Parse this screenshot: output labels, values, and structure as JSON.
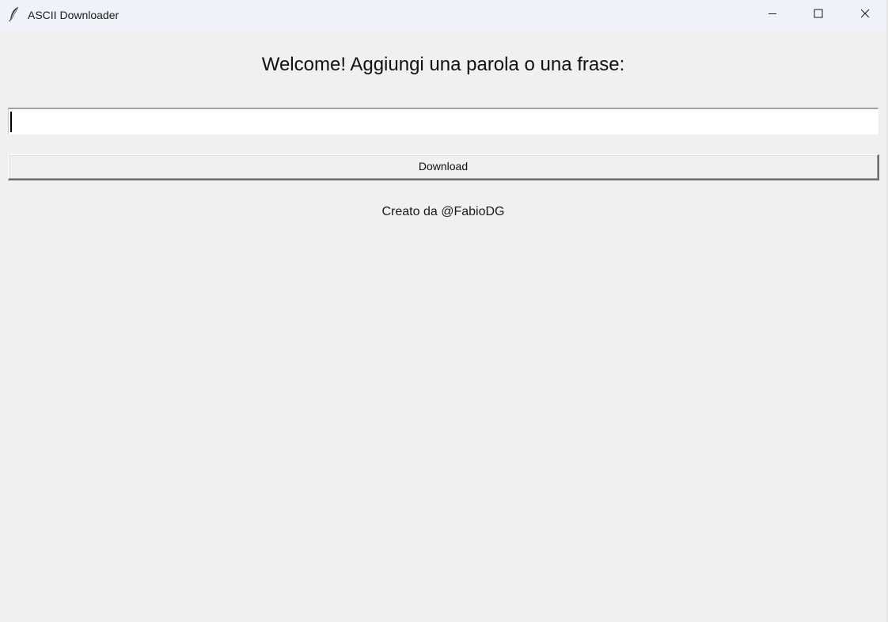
{
  "window": {
    "title": "ASCII Downloader",
    "icon": "feather-icon",
    "controls": [
      "minimize-icon",
      "maximize-icon",
      "close-icon"
    ]
  },
  "main": {
    "welcome_text": "Welcome! Aggiungi una parola o una frase:",
    "input_value": "",
    "download_label": "Download",
    "credit_text": "Creato da @FabioDG"
  },
  "colors": {
    "background": "#f0f0f0",
    "titlebar": "#eff3f9",
    "input_background": "#ffffff"
  }
}
